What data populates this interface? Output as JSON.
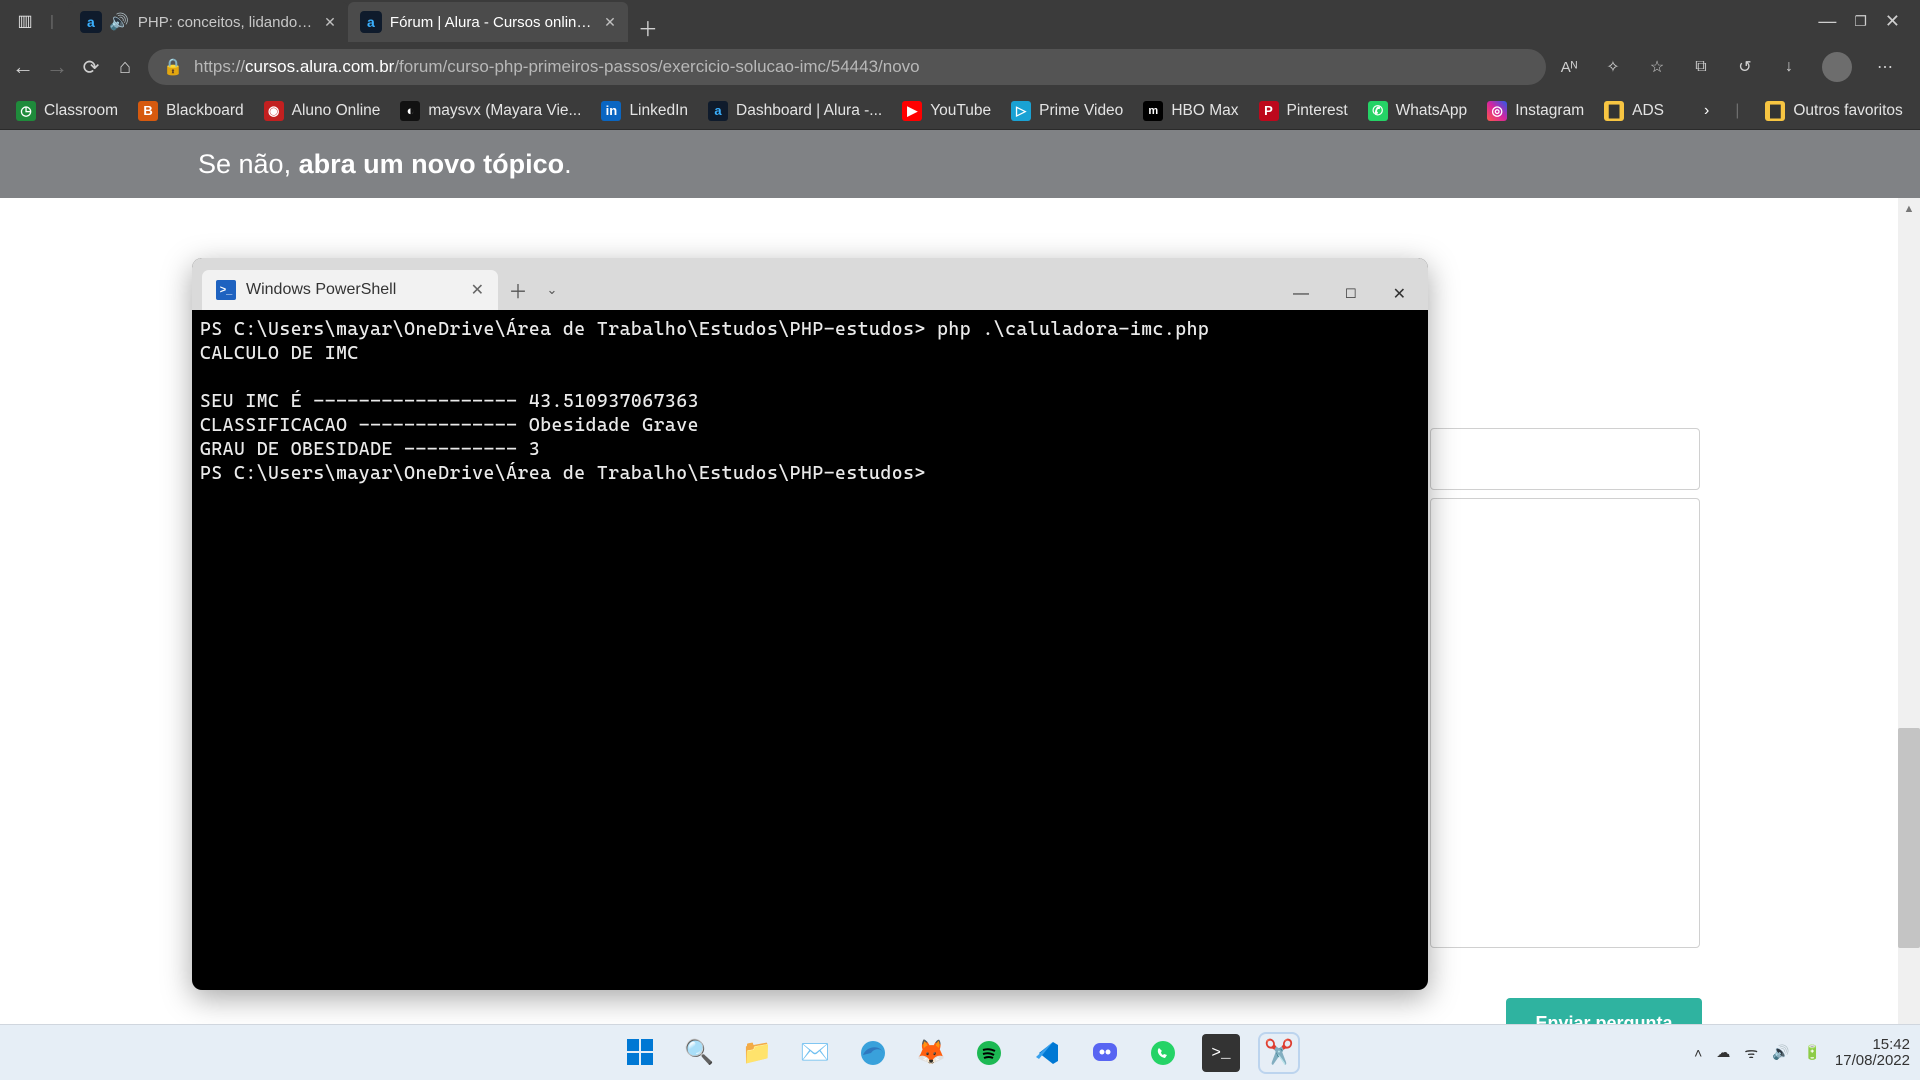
{
  "titlebar": {
    "tabs": [
      {
        "label": "PHP: conceitos, lidando com"
      },
      {
        "label": "Fórum | Alura - Cursos online de"
      }
    ]
  },
  "addr": {
    "domain_prefix": "https://",
    "domain": "cursos.alura.com.br",
    "path": "/forum/curso-php-primeiros-passos/exercicio-solucao-imc/54443/novo"
  },
  "bookmarks": [
    {
      "label": "Classroom",
      "bg": "#1f8b3b"
    },
    {
      "label": "Blackboard",
      "bg": "#d65a0f"
    },
    {
      "label": "Aluno Online",
      "bg": "#c22020"
    },
    {
      "label": "maysvx (Mayara Vie...",
      "bg": "#111111"
    },
    {
      "label": "LinkedIn",
      "bg": "#0a66c2"
    },
    {
      "label": "Dashboard | Alura -...",
      "bg": "#0f1b2c"
    },
    {
      "label": "YouTube",
      "bg": "#ff0000"
    },
    {
      "label": "Prime Video",
      "bg": "#1aa2d4"
    },
    {
      "label": "HBO Max",
      "bg": "#5a2e98"
    },
    {
      "label": "Pinterest",
      "bg": "#bd081c"
    },
    {
      "label": "WhatsApp",
      "bg": "#25d366"
    },
    {
      "label": "Instagram",
      "bg": "#d6249f"
    },
    {
      "label": "ADS",
      "bg": "#f7c542"
    }
  ],
  "otherBookmarks": "Outros favoritos",
  "banner": {
    "lead": "Se não, ",
    "bold": "abra um novo tópico",
    "tail": "."
  },
  "submit": "Enviar pergunta",
  "terminal": {
    "tabTitle": "Windows PowerShell",
    "lines": [
      "PS C:\\Users\\mayar\\OneDrive\\Área de Trabalho\\Estudos\\PHP-estudos> php .\\caluladora-imc.php",
      "CALCULO DE IMC",
      "",
      "SEU IMC É ------------------ 43.510937067363",
      "CLASSIFICACAO -------------- Obesidade Grave",
      "GRAU DE OBESIDADE ---------- 3",
      "PS C:\\Users\\mayar\\OneDrive\\Área de Trabalho\\Estudos\\PHP-estudos>"
    ]
  },
  "taskbar": {
    "time": "15:42",
    "date": "17/08/2022"
  }
}
